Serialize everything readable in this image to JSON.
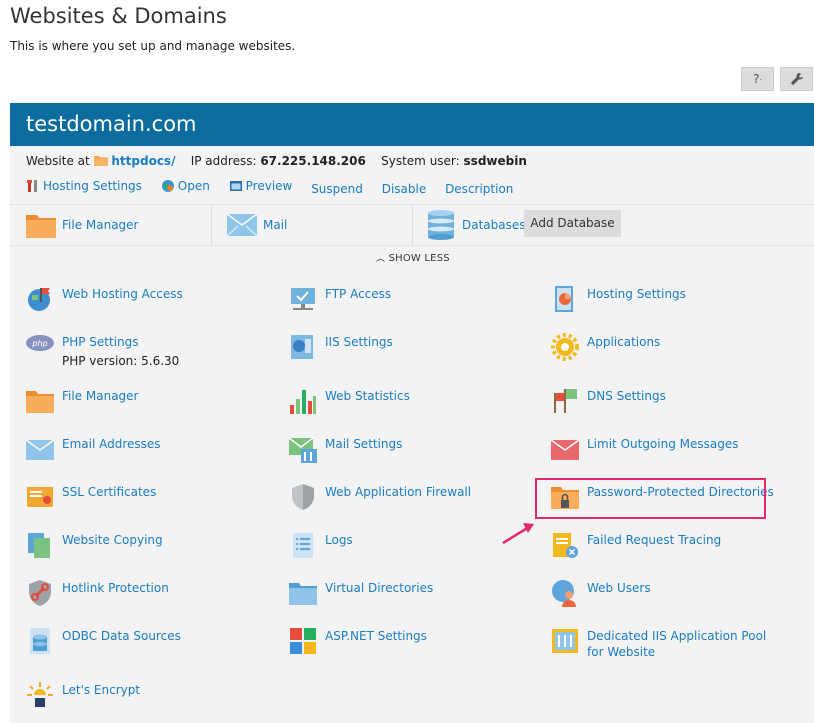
{
  "page": {
    "title": "Websites & Domains",
    "subtitle": "This is where you set up and manage websites."
  },
  "toolbar": {
    "help_label": "?",
    "settings_icon": "wrench-icon"
  },
  "domain": {
    "name": "testdomain.com",
    "website_at_label": "Website at",
    "website_path": "httpdocs/",
    "ip_label": "IP address:",
    "ip_value": "67.225.148.206",
    "user_label": "System user:",
    "user_value": "ssdwebin"
  },
  "actions": [
    {
      "label": "Hosting Settings",
      "icon": "tools-icon"
    },
    {
      "label": "Open",
      "icon": "globe-icon"
    },
    {
      "label": "Preview",
      "icon": "preview-icon"
    },
    {
      "label": "Suspend"
    },
    {
      "label": "Disable"
    },
    {
      "label": "Description"
    }
  ],
  "quick": {
    "file_manager": "File Manager",
    "mail": "Mail",
    "databases": "Databases",
    "add_database": "Add Database"
  },
  "show_less": "SHOW LESS",
  "features": [
    {
      "label": "Web Hosting Access",
      "icon": "web-hosting-access-icon"
    },
    {
      "label": "FTP Access",
      "icon": "ftp-icon"
    },
    {
      "label": "Hosting Settings",
      "icon": "hosting-settings-icon"
    },
    {
      "label": "PHP Settings",
      "sub": "PHP version: 5.6.30",
      "icon": "php-icon"
    },
    {
      "label": "IIS Settings",
      "icon": "iis-icon"
    },
    {
      "label": "Applications",
      "icon": "gear-icon"
    },
    {
      "label": "File Manager",
      "icon": "folder-icon"
    },
    {
      "label": "Web Statistics",
      "icon": "bar-chart-icon"
    },
    {
      "label": "DNS Settings",
      "icon": "dns-icon"
    },
    {
      "label": "Email Addresses",
      "icon": "envelope-icon"
    },
    {
      "label": "Mail Settings",
      "icon": "mail-settings-icon"
    },
    {
      "label": "Limit Outgoing Messages",
      "icon": "limit-mail-icon"
    },
    {
      "label": "SSL Certificates",
      "icon": "certificate-icon"
    },
    {
      "label": "Web Application Firewall",
      "icon": "shield-icon"
    },
    {
      "label": "Password-Protected Directories",
      "icon": "locked-folder-icon"
    },
    {
      "label": "Website Copying",
      "icon": "copy-icon"
    },
    {
      "label": "Logs",
      "icon": "log-icon"
    },
    {
      "label": "Failed Request Tracing",
      "icon": "failed-request-icon"
    },
    {
      "label": "Hotlink Protection",
      "icon": "hotlink-shield-icon"
    },
    {
      "label": "Virtual Directories",
      "icon": "virtual-folder-icon"
    },
    {
      "label": "Web Users",
      "icon": "web-users-icon"
    },
    {
      "label": "ODBC Data Sources",
      "icon": "database-icon"
    },
    {
      "label": "ASP.NET Settings",
      "icon": "aspnet-icon"
    },
    {
      "label": "Dedicated IIS Application Pool for Website",
      "icon": "app-pool-icon"
    },
    {
      "label": "Let's Encrypt",
      "icon": "lets-encrypt-icon"
    }
  ],
  "colors": {
    "header": "#0d6c9e",
    "link": "#1a7cc0",
    "highlight": "#e8266f",
    "panel": "#f3f3f3"
  }
}
